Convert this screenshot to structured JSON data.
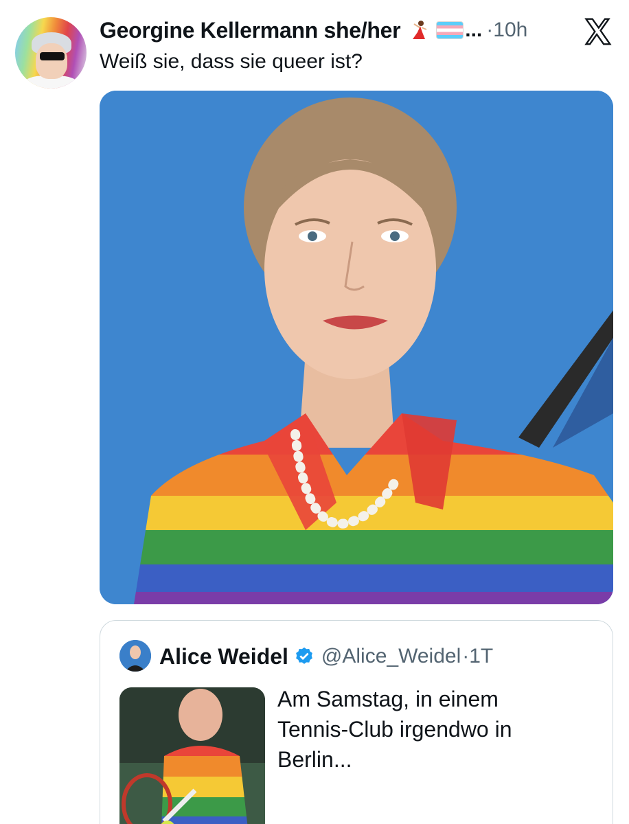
{
  "post": {
    "author_name": "Georgine Kellermann she/her",
    "author_emoji": "dancer-emoji",
    "flag": "transgender-flag-emoji",
    "ellipsis": "...",
    "time": "·10h",
    "platform_icon": "x-logo-icon",
    "text": "Weiß sie, dass sie queer ist?",
    "media_description_icon": "portrait-rainbow-blazer-image"
  },
  "quote": {
    "author_name": "Alice Weidel",
    "verified_icon": "verified-badge-icon",
    "handle": "@Alice_Weidel",
    "time": "·1T",
    "text": "Am Samstag, in einem Tennis-Club irgendwo in Berlin..."
  },
  "colors": {
    "text_primary": "#0f1419",
    "text_secondary": "#536471",
    "border": "#cfd9de",
    "verified": "#1d9bf0",
    "photo_background": "#3e86cf"
  }
}
